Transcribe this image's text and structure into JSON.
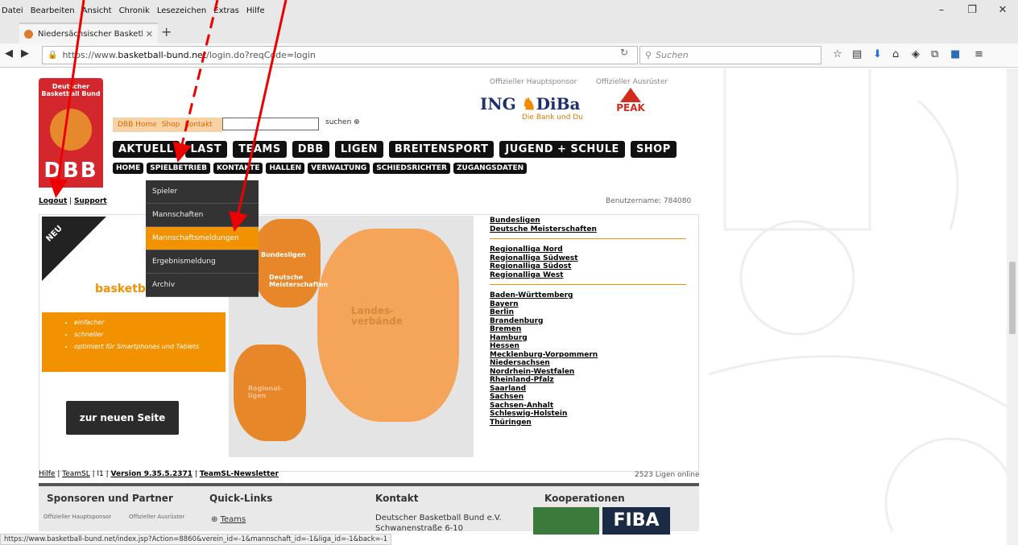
{
  "menubar": {
    "items": [
      "Datei",
      "Bearbeiten",
      "Ansicht",
      "Chronik",
      "Lesezeichen",
      "Extras",
      "Hilfe"
    ]
  },
  "tab": {
    "title": "Niedersächsischer Basketbal"
  },
  "url": {
    "prefix": "https://www.",
    "host": "basketball-bund.net",
    "path": "/login.do?reqCode=login"
  },
  "search": {
    "placeholder": "Suchen"
  },
  "sponsors": {
    "main_label": "Offizieller Hauptsponsor",
    "outfit_label": "Offizieller Ausrüster",
    "ing": "ING",
    "diba": "DiBa",
    "ing_sub": "Die Bank und Du",
    "peak": "PEAK"
  },
  "logo": {
    "line1": "Deutscher",
    "line2": "Basketball Bund",
    "dbb": "DBB"
  },
  "toplinks": [
    "DBB Home",
    "Shop",
    "Kontakt"
  ],
  "search_btn": "suchen",
  "mainnav": [
    "AKTUELL",
    "LAST",
    "TEAMS",
    "DBB",
    "LIGEN",
    "BREITENSPORT",
    "JUGEND + SCHULE",
    "SHOP"
  ],
  "subnav": [
    "HOME",
    "SPIELBETRIEB",
    "KONTAKTE",
    "HALLEN",
    "VERWALTUNG",
    "SCHIEDSRICHTER",
    "ZUGANGSDATEN"
  ],
  "logout": "Logout",
  "support": "Support",
  "username": "Benutzername: 784080",
  "dropdown": [
    "Spieler",
    "Mannschaften",
    "Mannschaftsmeldungen",
    "Ergebnismeldung",
    "Archiv"
  ],
  "promo": {
    "neu": "NEU",
    "brand": "basketba",
    "bullets": [
      "einfacher",
      "schneller",
      "optimiert für Smartphones und Tablets"
    ],
    "button": "zur neuen Seite"
  },
  "map": {
    "bund": "Bundesligen",
    "dm": "Deutsche Meisterschaften",
    "landes": "Landes-\nverbände",
    "regional": "Regional-\nligen"
  },
  "links": {
    "top": [
      "Bundesligen",
      "Deutsche Meisterschaften"
    ],
    "regional": [
      "Regionalliga Nord",
      "Regionalliga Südwest",
      "Regionalliga Südost",
      "Regionalliga West"
    ],
    "states": [
      "Baden-Württemberg",
      "Bayern",
      "Berlin",
      "Brandenburg",
      "Bremen",
      "Hamburg",
      "Hessen",
      "Mecklenburg-Vorpommern",
      "Niedersachsen",
      "Nordrhein-Westfalen",
      "Rheinland-Pfalz",
      "Saarland",
      "Sachsen",
      "Sachsen-Anhalt",
      "Schleswig-Holstein",
      "Thüringen"
    ]
  },
  "footer": {
    "hilfe": "Hilfe",
    "teamsl": "TeamSL",
    "l1": "l1",
    "version": "Version 9.35.5.2371",
    "newsletter": "TeamSL-Newsletter",
    "online": "2523 Ligen online"
  },
  "bottom": {
    "h1": "Sponsoren und Partner",
    "h2": "Quick-Links",
    "h3": "Kontakt",
    "h4": "Kooperationen",
    "ql1": "Teams",
    "addr1": "Deutscher Basketball Bund e.V.",
    "addr2": "Schwanenstraße 6-10",
    "fiba": "FIBA"
  },
  "status": "https://www.basketball-bund.net/index.jsp?Action=8860&verein_id=-1&mannschaft_id=-1&liga_id=-1&back=-1"
}
